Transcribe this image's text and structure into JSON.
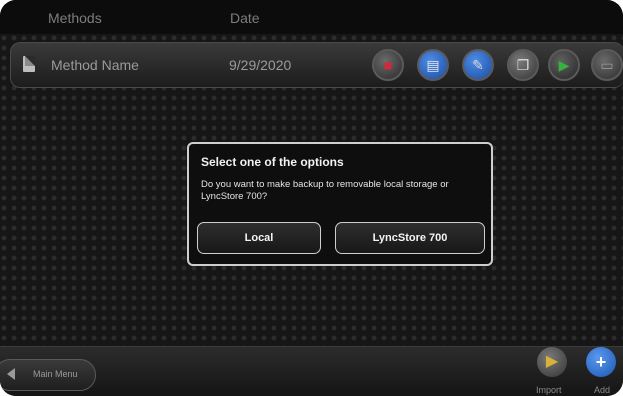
{
  "header": {
    "col_methods": "Methods",
    "col_date": "Date"
  },
  "row": {
    "name": "Method Name",
    "date": "9/29/2020",
    "actions": [
      {
        "icon": "floppy-disk-icon",
        "color": "#d6283b"
      },
      {
        "icon": "printer-icon",
        "color": "#2a6fd6"
      },
      {
        "icon": "edit-document-icon",
        "color": "#2a6fd6"
      },
      {
        "icon": "copy-icon",
        "color": "#7a7a7a"
      },
      {
        "icon": "play-icon",
        "color": "#2f9e3a"
      },
      {
        "icon": "trash-icon",
        "color": "#8a8a8a"
      }
    ]
  },
  "dialog": {
    "title": "Select one of the options",
    "message": "Do you want to make backup to removable local storage or LyncStore 700?",
    "btn_local": "Local",
    "btn_lyncstore": "LyncStore 700"
  },
  "footer": {
    "main_menu": "Main Menu",
    "import": "Import",
    "add": "Add"
  }
}
